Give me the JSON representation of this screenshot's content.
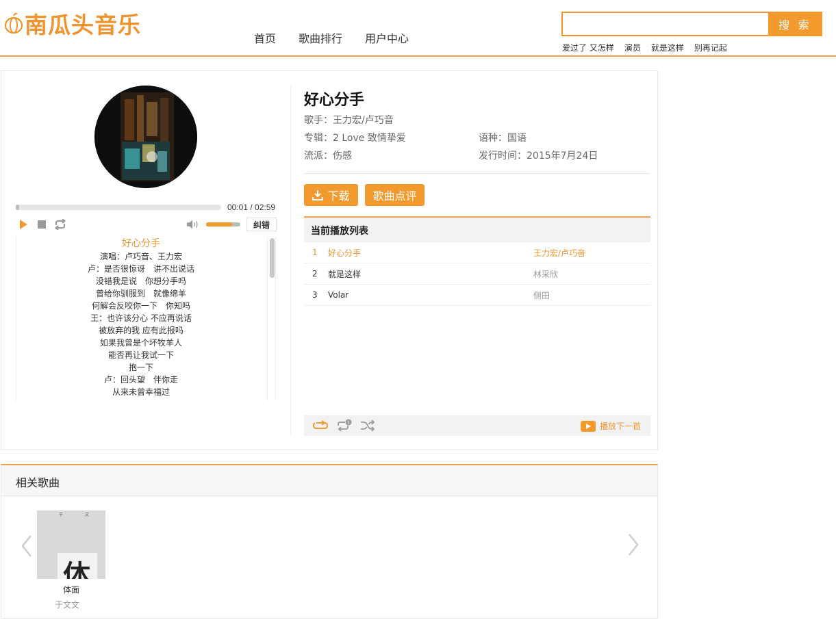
{
  "brand": {
    "logo_text": "南瓜头音乐",
    "accent": "#f39a2e"
  },
  "nav": {
    "items": [
      "首页",
      "歌曲排行",
      "用户中心"
    ]
  },
  "search": {
    "value": "",
    "button_label": "搜 索",
    "hot_words": [
      "爱过了 又怎样",
      "演员",
      "就是这样",
      "别再记起"
    ]
  },
  "player": {
    "time_display": "00:01 / 02:59",
    "progress_fraction": 0.006,
    "volume_fraction": 0.75,
    "correct_label": "纠错"
  },
  "lyrics": {
    "title": "好心分手",
    "lines": [
      "演唱：卢巧音、王力宏",
      "卢：是否很惊讶　讲不出说话",
      "没错我是说　你想分手吗",
      "曾给你驯服到　就像绵羊",
      "何解会反咬你一下　你知吗",
      "王：也许该分心 不应再说话",
      "被放弃的我 应有此报吗",
      "如果我曾是个坏牧羊人",
      "能否再让我试一下",
      "抱一下",
      "卢：回头望　伴你走",
      "从来未曾幸福过"
    ]
  },
  "song": {
    "title": "好心分手",
    "singer": "歌手：王力宏/卢巧音",
    "album": "专辑：2 Love 致情挚爱",
    "language": "语种：国语",
    "genre": "流派：伤感",
    "release": "发行时间：2015年7月24日",
    "download_label": "下载",
    "comment_label": "歌曲点评"
  },
  "playlist": {
    "header": "当前播放列表",
    "rows": [
      {
        "num": "1",
        "name": "好心分手",
        "artist": "王力宏/卢巧音"
      },
      {
        "num": "2",
        "name": "就是这样",
        "artist": "林采欣"
      },
      {
        "num": "3",
        "name": "Volar",
        "artist": "侧田"
      }
    ],
    "next_label": "播放下一首"
  },
  "related": {
    "header": "相关歌曲",
    "items": [
      {
        "name": "体面",
        "artist": "于文文",
        "cover_text": "体"
      }
    ]
  }
}
